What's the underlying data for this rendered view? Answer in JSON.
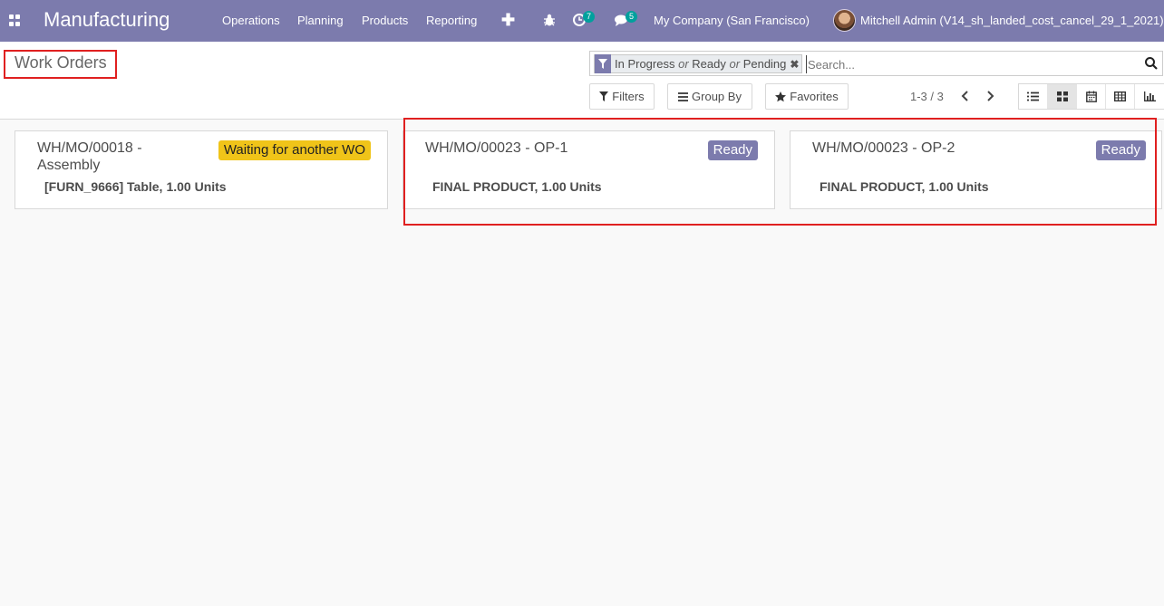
{
  "navbar": {
    "app_name": "Manufacturing",
    "menu": [
      "Operations",
      "Planning",
      "Products",
      "Reporting"
    ],
    "activity_count": "7",
    "messages_count": "5",
    "company": "My Company (San Francisco)",
    "user": "Mitchell Admin (V14_sh_landed_cost_cancel_29_1_2021)"
  },
  "breadcrumb": {
    "title": "Work Orders"
  },
  "search": {
    "facet": {
      "v1": "In Progress",
      "or1": "or",
      "v2": "Ready",
      "or2": "or",
      "v3": "Pending"
    },
    "placeholder": "Search..."
  },
  "buttons": {
    "filters": "Filters",
    "group_by": "Group By",
    "favorites": "Favorites"
  },
  "pager": {
    "value": "1-3 / 3"
  },
  "cards": [
    {
      "title_line1": "WH/MO/00018 -",
      "title_line2": "Assembly",
      "product": "[FURN_9666] Table,",
      "qty": "1.00 Units",
      "status": "Waiting for another WO"
    },
    {
      "title_line1": "WH/MO/00023 - OP-1",
      "product": "FINAL PRODUCT,",
      "qty": "1.00 Units",
      "status": "Ready"
    },
    {
      "title_line1": "WH/MO/00023 - OP-2",
      "product": "FINAL PRODUCT,",
      "qty": "1.00 Units",
      "status": "Ready"
    }
  ],
  "colors": {
    "navbar": "#7c7bad",
    "waiting_badge": "#f0c419",
    "ready_badge": "#7c7bad",
    "highlight": "#e02020"
  }
}
